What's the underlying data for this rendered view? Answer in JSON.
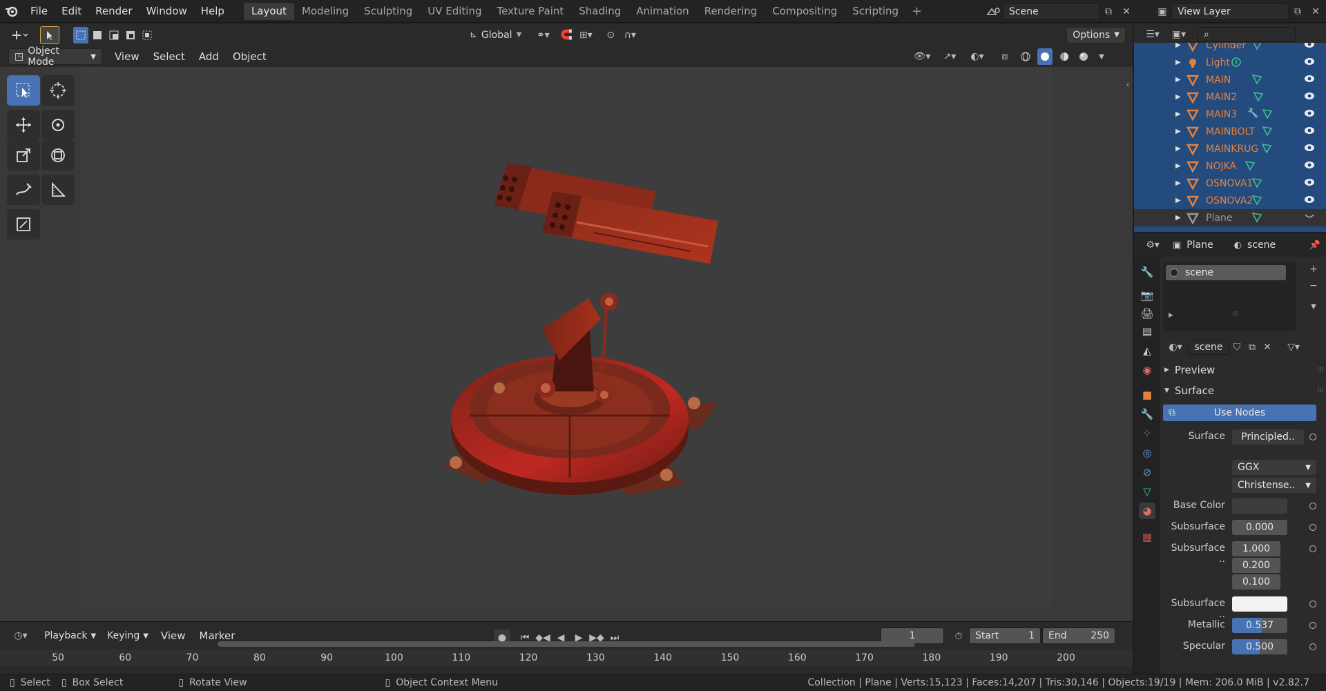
{
  "topbar": {
    "menus": [
      "File",
      "Edit",
      "Render",
      "Window",
      "Help"
    ],
    "workspaces": [
      "Layout",
      "Modeling",
      "Sculpting",
      "UV Editing",
      "Texture Paint",
      "Shading",
      "Animation",
      "Rendering",
      "Compositing",
      "Scripting"
    ],
    "active_workspace": "Layout",
    "scene_name": "Scene",
    "view_layer": "View Layer"
  },
  "toolheader": {
    "orientation": "Global",
    "options": "Options"
  },
  "viewheader": {
    "mode": "Object Mode",
    "menus": [
      "View",
      "Select",
      "Add",
      "Object"
    ]
  },
  "outliner": {
    "items": [
      {
        "name": "Cylinder",
        "type": "mesh"
      },
      {
        "name": "Light",
        "type": "light"
      },
      {
        "name": "MAIN",
        "type": "mesh"
      },
      {
        "name": "MAIN2",
        "type": "mesh"
      },
      {
        "name": "MAIN3",
        "type": "mesh",
        "modifier": true
      },
      {
        "name": "MAINBOLT",
        "type": "mesh"
      },
      {
        "name": "MAINKRUG",
        "type": "mesh"
      },
      {
        "name": "NOJKA",
        "type": "mesh"
      },
      {
        "name": "OSNOVA1",
        "type": "mesh"
      },
      {
        "name": "OSNOVA2",
        "type": "mesh"
      },
      {
        "name": "Plane",
        "type": "mesh",
        "active": true
      }
    ]
  },
  "properties": {
    "object": "Plane",
    "material_header": "scene",
    "slot": "scene",
    "material": "scene",
    "preview": "Preview",
    "surface_section": "Surface",
    "use_nodes": "Use Nodes",
    "surface_label": "Surface",
    "surface_value": "Principled..",
    "distribution": "GGX",
    "subsurface_method": "Christense..",
    "fields": {
      "base_color": "Base Color",
      "subsurface": "Subsurface",
      "subsurface_val": "0.000",
      "subsurface_radius": "Subsurface ..",
      "radius_1": "1.000",
      "radius_2": "0.200",
      "radius_3": "0.100",
      "subsurface_color": "Subsurface ..",
      "metallic": "Metallic",
      "metallic_val": "0.537",
      "specular": "Specular",
      "specular_val": "0.500"
    },
    "metallic_fraction": 0.537,
    "specular_fraction": 0.5
  },
  "timeline": {
    "menus": [
      "Playback",
      "Keying",
      "View",
      "Marker"
    ],
    "current_frame": "1",
    "start_label": "Start",
    "start": "1",
    "end_label": "End",
    "end": "250",
    "ruler": [
      "50",
      "60",
      "70",
      "80",
      "90",
      "100",
      "110",
      "120",
      "130",
      "140",
      "150",
      "160",
      "170",
      "180",
      "190",
      "200"
    ]
  },
  "status": {
    "select": "Select",
    "box_select": "Box Select",
    "rotate": "Rotate View",
    "context": "Object Context Menu",
    "info": "Collection | Plane | Verts:15,123 | Faces:14,207 | Tris:30,146 | Objects:19/19 | Mem: 206.0 MiB | v2.82.7"
  },
  "colors": {
    "accent": "#4772b3",
    "object_orange": "#e8813f",
    "mesh_data_green": "#3fbf8f",
    "selected_row": "#234b7d"
  }
}
